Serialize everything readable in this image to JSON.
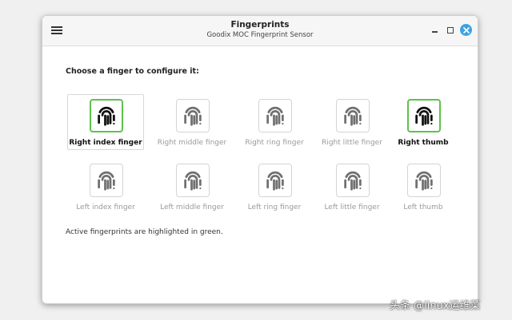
{
  "window": {
    "title": "Fingerprints",
    "subtitle": "Goodix MOC Fingerprint Sensor"
  },
  "main": {
    "heading": "Choose a finger to configure it:",
    "note": "Active fingerprints are highlighted in green."
  },
  "fingers": {
    "right_index": {
      "label": "Right index finger",
      "active": true,
      "selected": true
    },
    "right_middle": {
      "label": "Right middle finger",
      "active": false
    },
    "right_ring": {
      "label": "Right ring finger",
      "active": false
    },
    "right_little": {
      "label": "Right little finger",
      "active": false
    },
    "right_thumb": {
      "label": "Right thumb",
      "active": true
    },
    "left_index": {
      "label": "Left index finger",
      "active": false
    },
    "left_middle": {
      "label": "Left middle finger",
      "active": false
    },
    "left_ring": {
      "label": "Left ring finger",
      "active": false
    },
    "left_little": {
      "label": "Left little finger",
      "active": false
    },
    "left_thumb": {
      "label": "Left thumb",
      "active": false
    }
  },
  "icons": {
    "fingerprint": "fingerprint-icon",
    "menu": "hamburger-menu-icon",
    "minimize": "minimize-icon",
    "maximize": "maximize-icon",
    "close": "close-icon"
  },
  "colors": {
    "active_border": "#5dc24c",
    "active_icon": "#111111",
    "inactive_icon": "#707070",
    "inactive_label": "#9a9a9a",
    "close_button": "#3ea2e0"
  },
  "watermark": "头条 @linux运维菜"
}
